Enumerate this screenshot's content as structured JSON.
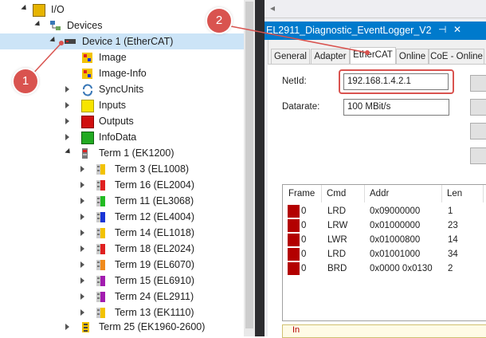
{
  "tree": {
    "io": "I/O",
    "devices": "Devices",
    "device1": "Device 1 (EtherCAT)",
    "image": "Image",
    "image_info": "Image-Info",
    "syncunits": "SyncUnits",
    "inputs": "Inputs",
    "outputs": "Outputs",
    "infodata": "InfoData",
    "term1": "Term 1 (EK1200)",
    "terms": [
      {
        "label": "Term 3 (EL1008)",
        "color": "#f2c200"
      },
      {
        "label": "Term 16 (EL2004)",
        "color": "#e02020"
      },
      {
        "label": "Term 11 (EL3068)",
        "color": "#22bb22"
      },
      {
        "label": "Term 12 (EL4004)",
        "color": "#1a35d6"
      },
      {
        "label": "Term 14 (EL1018)",
        "color": "#f2c200"
      },
      {
        "label": "Term 18 (EL2024)",
        "color": "#e02020"
      },
      {
        "label": "Term 19 (EL6070)",
        "color": "#f08a1c"
      },
      {
        "label": "Term 15 (EL6910)",
        "color": "#a21caf"
      },
      {
        "label": "Term 24 (EL2911)",
        "color": "#a21caf"
      },
      {
        "label": "Term 13 (EK1110)",
        "color": "#f2c200"
      }
    ],
    "term25": "Term 25 (EK1960-2600)"
  },
  "document": {
    "title": "EL2911_Diagnostic_EventLogger_V2",
    "pin_glyph": "⊣",
    "close_glyph": "✕",
    "toolbar_glyph": "◂"
  },
  "tabs": [
    "General",
    "Adapter",
    "EtherCAT",
    "Online",
    "CoE - Online"
  ],
  "active_tab": "EtherCAT",
  "form": {
    "netid_label": "NetId:",
    "netid_value": "192.168.1.4.2.1",
    "datarate_label": "Datarate:",
    "datarate_value": "100 MBit/s"
  },
  "frames_table": {
    "headers": [
      "Frame",
      "Cmd",
      "Addr",
      "Len"
    ],
    "rows": [
      {
        "frame": "0",
        "cmd": "LRD",
        "addr": "0x09000000",
        "len": "1"
      },
      {
        "frame": "0",
        "cmd": "LRW",
        "addr": "0x01000000",
        "len": "23"
      },
      {
        "frame": "0",
        "cmd": "LWR",
        "addr": "0x01000800",
        "len": "14"
      },
      {
        "frame": "0",
        "cmd": "LRD",
        "addr": "0x01001000",
        "len": "34"
      },
      {
        "frame": "0",
        "cmd": "BRD",
        "addr": "0x0000 0x0130",
        "len": "2"
      }
    ]
  },
  "bottom_text": "In",
  "annotations": {
    "badge1": "1",
    "badge2": "2",
    "color": "#d9534f"
  }
}
